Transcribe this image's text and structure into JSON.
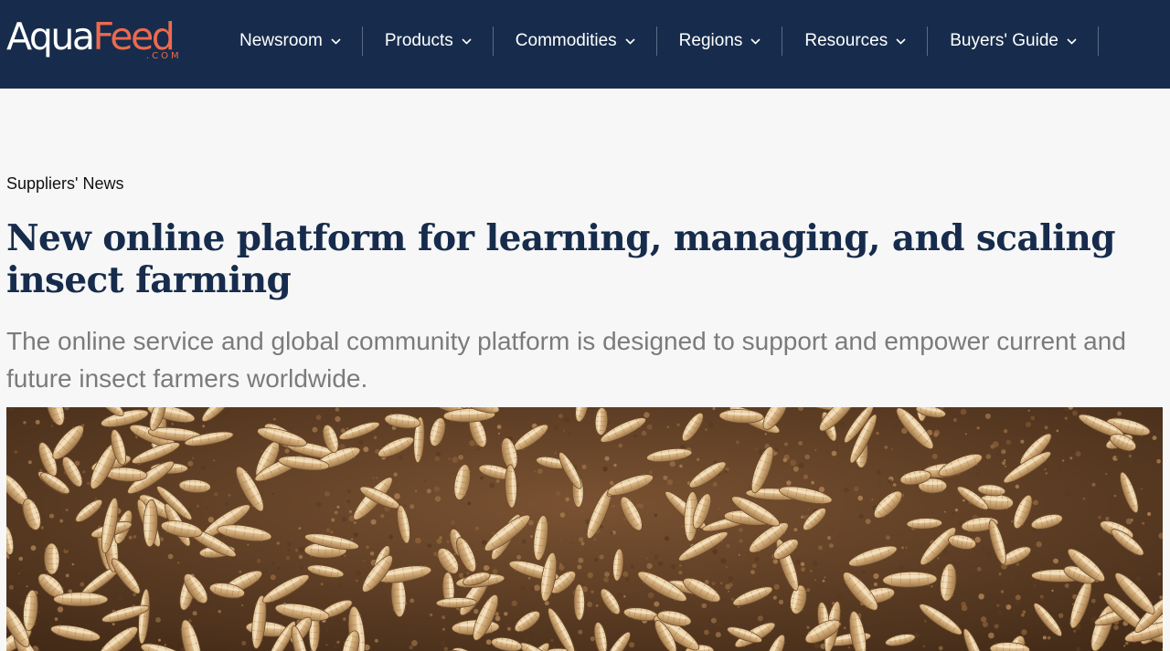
{
  "site": {
    "logo_primary": "Aqua",
    "logo_accent": "Feed",
    "logo_sub": ".COM"
  },
  "nav": {
    "items": [
      {
        "label": "Newsroom"
      },
      {
        "label": "Products"
      },
      {
        "label": "Commodities"
      },
      {
        "label": "Regions"
      },
      {
        "label": "Resources"
      },
      {
        "label": "Buyers' Guide"
      }
    ]
  },
  "article": {
    "category": "Suppliers' News",
    "title": "New online platform for learning, managing, and scaling insect farming",
    "subtitle": "The online service and global community platform is designed to support and empower current and future insect farmers worldwide."
  },
  "colors": {
    "header_bg": "#172c4c",
    "logo_accent": "#ec6a4f",
    "title": "#172c4c",
    "subtitle": "#7b7b7b"
  },
  "icons": {
    "nav_dropdown": "chevron-down-icon"
  }
}
